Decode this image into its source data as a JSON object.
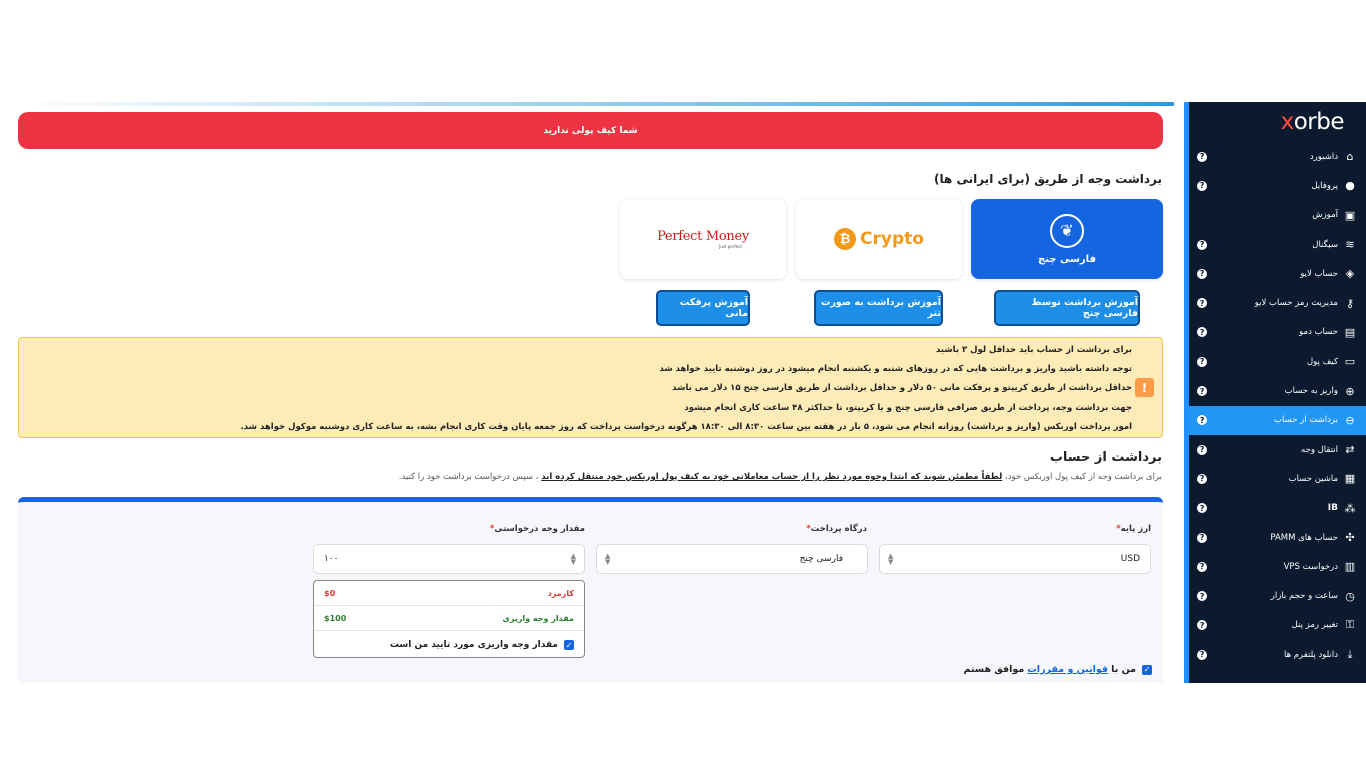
{
  "brand": {
    "logo_main": "orbe",
    "logo_accent": "x"
  },
  "sidebar": {
    "items": [
      {
        "label": "داشبورد",
        "icon": "home-icon",
        "glyph": "⌂",
        "help": "?"
      },
      {
        "label": "پروفایل",
        "icon": "user-icon",
        "glyph": "●",
        "help": "?"
      },
      {
        "label": "آموزش",
        "icon": "video-icon",
        "glyph": "▣",
        "help": ""
      },
      {
        "label": "سیگنال",
        "icon": "wifi-icon",
        "glyph": "≋",
        "help": "?"
      },
      {
        "label": "حساب لایو",
        "icon": "live-account-icon",
        "glyph": "◈",
        "help": "?"
      },
      {
        "label": "مدیریت رمز حساب لایو",
        "icon": "key-icon",
        "glyph": "⚷",
        "help": "?"
      },
      {
        "label": "حساب دمو",
        "icon": "demo-account-icon",
        "glyph": "▤",
        "help": "?"
      },
      {
        "label": "کیف پول",
        "icon": "wallet-icon",
        "glyph": "▭",
        "help": "?"
      },
      {
        "label": "واریز به حساب",
        "icon": "deposit-icon",
        "glyph": "⊕",
        "help": "?"
      },
      {
        "label": "برداشت از حساب",
        "icon": "withdraw-icon",
        "glyph": "⊖",
        "help": "?",
        "active": true
      },
      {
        "label": "انتقال وجه",
        "icon": "transfer-icon",
        "glyph": "⇄",
        "help": "?"
      },
      {
        "label": "ماشین حساب",
        "icon": "calculator-icon",
        "glyph": "▦",
        "help": "?"
      },
      {
        "label": "IB",
        "icon": "ib-icon",
        "glyph": "⁂",
        "help": "?"
      },
      {
        "label": "حساب های PAMM",
        "icon": "pamm-icon",
        "glyph": "✣",
        "help": "?"
      },
      {
        "label": "درخواست VPS",
        "icon": "vps-icon",
        "glyph": "▥",
        "help": "?"
      },
      {
        "label": "ساعت و حجم بازار",
        "icon": "clock-icon",
        "glyph": "◷",
        "help": "?"
      },
      {
        "label": "تغییر رمز پنل",
        "icon": "lock-icon",
        "glyph": "⚿",
        "help": "?"
      },
      {
        "label": "دانلود پلتفرم ها",
        "icon": "download-icon",
        "glyph": "⤓",
        "help": "?"
      }
    ]
  },
  "alert": {
    "no_wallet": "شما کیف پولی ندارید"
  },
  "methods": {
    "title": "برداشت وجه از طریق (برای ایرانی ها)",
    "farsi_change": "فارسی چنج",
    "crypto": "Crypto",
    "perfect_money": "Perfect Money",
    "perfect_money_sub": "Just perfect"
  },
  "tutorials": {
    "farsi_change": "آموزش برداشت توسط فارسی چنج",
    "tether": "آموزش برداشت به صورت تتر",
    "perfect_money": "آموزش پرفکت مانی"
  },
  "notice": {
    "lines": [
      "برای برداشت از حساب باید حداقل لول ۳ باشید",
      "توجه داشته باشید واریز و برداشت هایی که در روزهای شنبه و یکشنبه انجام میشود در روز دوشنبه تایید خواهد شد",
      "حداقل برداشت از طریق کریپتو و پرفکت مانی ۵۰ دلار و حداقل برداشت از طریق فارسی چنج ۱۵ دلار می باشد",
      "جهت برداشت وجه، پرداخت از طریق صرافی فارسی چنج و یا کریپتو، تا حداکثر ۴۸ ساعت کاری انجام میشود",
      "امور پرداخت اوربکس (واریز و برداشت) روزانه انجام می شود، ۵ بار در هفته بین ساعت ۸:۳۰ الی ۱۸:۳۰ هرگونه درخواست پرداخت که روز جمعه پایان وقت کاری انجام بشه، به ساعت کاری دوشنبه موکول خواهد شد."
    ]
  },
  "withdraw": {
    "title": "برداشت از حساب",
    "sub_prefix": "برای برداشت وجه از کیف پول اوربکس خود،",
    "sub_bold": "لطفاً مطمئن شوید که ابتدا وجوه مورد نظر را از حساب معاملاتی خود به کیف پول اوربکس خود منتقل کرده اید",
    "sub_suffix": "، سپس درخواست برداشت خود را کنید."
  },
  "form": {
    "base_currency_label": "ارز پایه",
    "base_currency_value": "USD",
    "gateway_label": "درگاه پرداخت",
    "gateway_value": "فارسی چنج",
    "amount_label": "مقدار وجه درخواستی",
    "amount_value": "۱۰۰",
    "required_mark": "*",
    "fee_label": "کارمزد",
    "fee_value": "$0",
    "deposit_amount_label": "مقدار وجه واریزی",
    "deposit_amount_value": "$100",
    "confirm_label": "مقدار وجه واریزی مورد تایید من است",
    "terms_prefix": "من با",
    "terms_link": "قوانین و مقررات",
    "terms_suffix": "موافق هستم"
  },
  "colors": {
    "accent": "#1565e0",
    "alert": "#ee3344",
    "sidebar": "#0b1a2e",
    "active": "#2196f3"
  }
}
